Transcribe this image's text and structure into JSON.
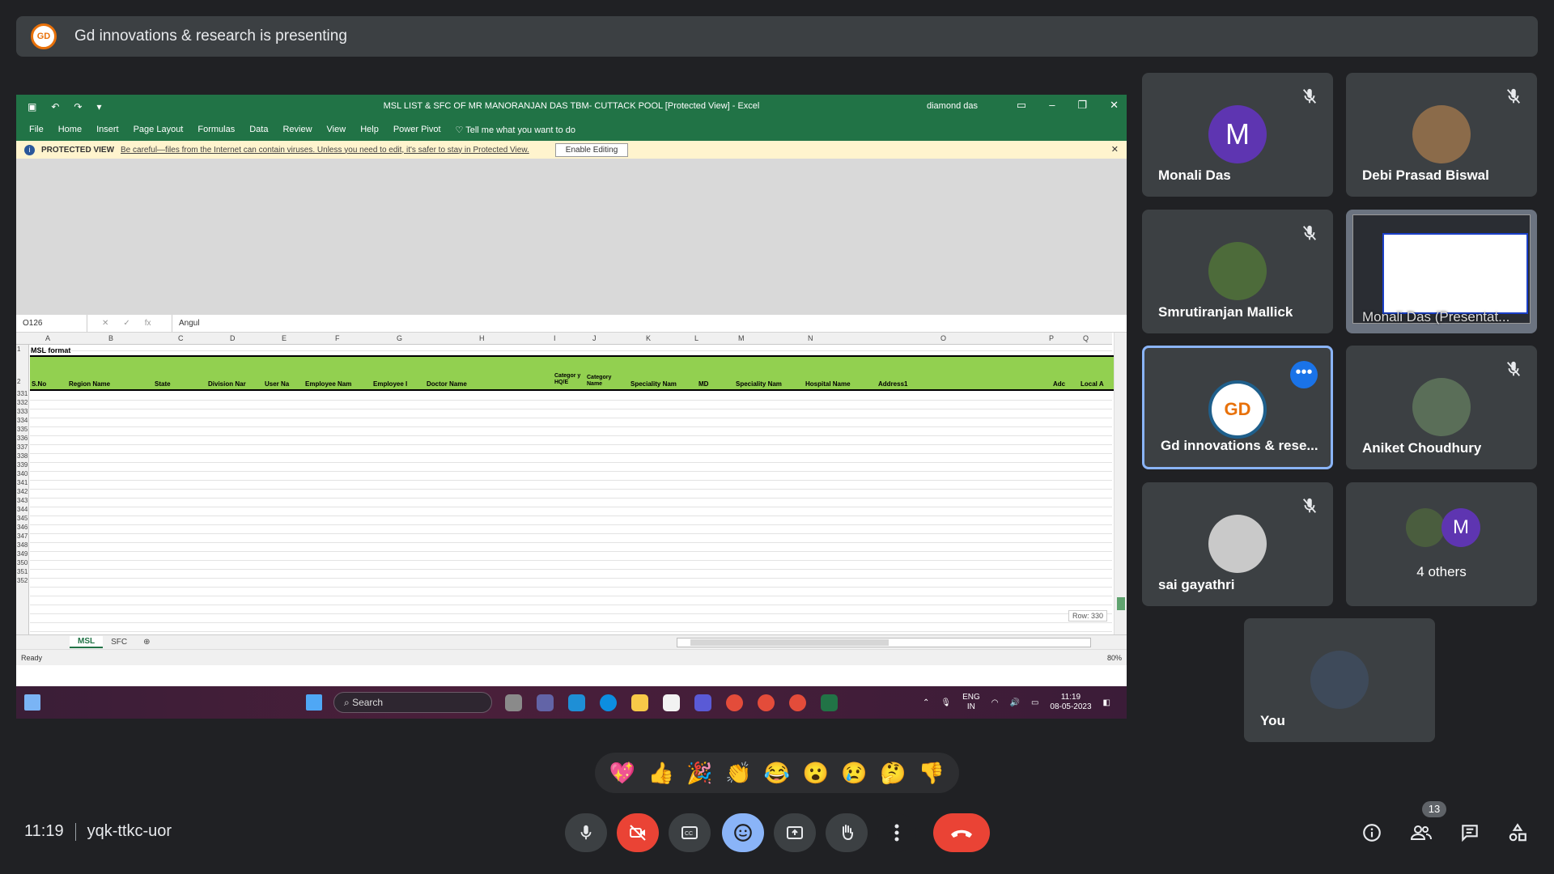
{
  "banner": {
    "text": "Gd innovations & research is presenting"
  },
  "excel": {
    "doc_title": "MSL LIST & SFC OF MR MANORANJAN DAS TBM- CUTTACK POOL  [Protected View]  -  Excel",
    "user": "diamond das",
    "menu": [
      "File",
      "Home",
      "Insert",
      "Page Layout",
      "Formulas",
      "Data",
      "Review",
      "View",
      "Help",
      "Power Pivot",
      "Tell me what you want to do"
    ],
    "protected_label": "PROTECTED VIEW",
    "protected_msg": "Be careful—files from the Internet can contain viruses. Unless you need to edit, it's safer to stay in Protected View.",
    "enable_editing": "Enable Editing",
    "name_box": "O126",
    "formula_value": "Angul",
    "columns": [
      "A",
      "B",
      "C",
      "D",
      "E",
      "F",
      "G",
      "H",
      "I",
      "J",
      "K",
      "L",
      "M",
      "N",
      "O",
      "P",
      "Q"
    ],
    "row1_label": "MSL format",
    "headers": [
      "S.No",
      "Region Name",
      "State",
      "Division Nar",
      "User Na",
      "Employee Nam",
      "Employee I",
      "Doctor Name",
      "Categor y HQ/E",
      "Category Name",
      "Speciality Nam",
      "MD",
      "Speciality Nam",
      "Hospital Name",
      "Address1",
      "Adc",
      "Local A"
    ],
    "rows": [
      "1",
      "2",
      "331",
      "332",
      "333",
      "334",
      "335",
      "336",
      "337",
      "338",
      "339",
      "340",
      "341",
      "342",
      "343",
      "344",
      "345",
      "346",
      "347",
      "348",
      "349",
      "350",
      "351",
      "352"
    ],
    "row_tip": "Row: 330",
    "sheets": [
      "MSL",
      "SFC"
    ],
    "status": "Ready",
    "zoom": "80%"
  },
  "taskbar": {
    "search": "Search",
    "lang1": "ENG",
    "lang2": "IN",
    "time": "11:19",
    "date": "08-05-2023"
  },
  "participants": [
    {
      "name": "Monali Das",
      "initial": "M",
      "color": "#5e35b1",
      "muted": true
    },
    {
      "name": "Debi Prasad Biswal",
      "muted": true
    },
    {
      "name": "Smrutiranjan Mallick",
      "muted": true
    },
    {
      "name": "Monali Das (Presentat..."
    },
    {
      "name": "Gd innovations & rese..."
    },
    {
      "name": "Aniket Choudhury",
      "muted": true
    },
    {
      "name": "sai gayathri",
      "muted": true
    },
    {
      "name": "4 others",
      "initial": "M"
    },
    {
      "name": "You"
    }
  ],
  "reactions": [
    "💖",
    "👍",
    "🎉",
    "👏",
    "😂",
    "😮",
    "😢",
    "🤔",
    "👎"
  ],
  "meeting": {
    "time": "11:19",
    "code": "yqk-ttkc-uor",
    "people_count": "13"
  }
}
